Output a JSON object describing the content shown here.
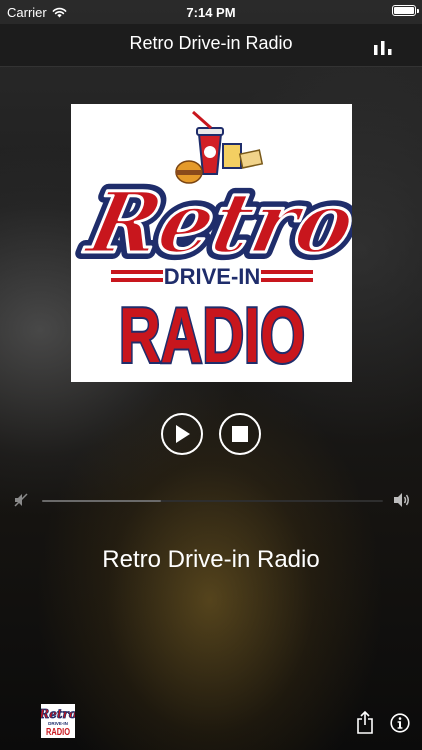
{
  "status_bar": {
    "carrier": "Carrier",
    "time": "7:14 PM",
    "icons": [
      "wifi-icon",
      "battery-icon"
    ]
  },
  "nav": {
    "title": "Retro Drive-in Radio",
    "right_icon": "equalizer-icon"
  },
  "artwork": {
    "logo_text_top": "Retro",
    "logo_text_mid": "DRIVE-IN",
    "logo_text_bottom": "RADIO",
    "colors": {
      "red": "#c8161d",
      "navy": "#1f2d6b",
      "white": "#ffffff"
    }
  },
  "controls": {
    "play_icon": "play-icon",
    "stop_icon": "stop-icon"
  },
  "volume": {
    "level": 0.35,
    "min_icon": "volume-mute-icon",
    "max_icon": "volume-high-icon"
  },
  "now_playing": {
    "station": "Retro Drive-in Radio"
  },
  "bottom_bar": {
    "thumb_logo_text_top": "Retro",
    "thumb_logo_text_mid": "DRIVE-IN",
    "thumb_logo_text_bottom": "RADIO",
    "share_icon": "share-icon",
    "info_icon": "info-icon"
  }
}
